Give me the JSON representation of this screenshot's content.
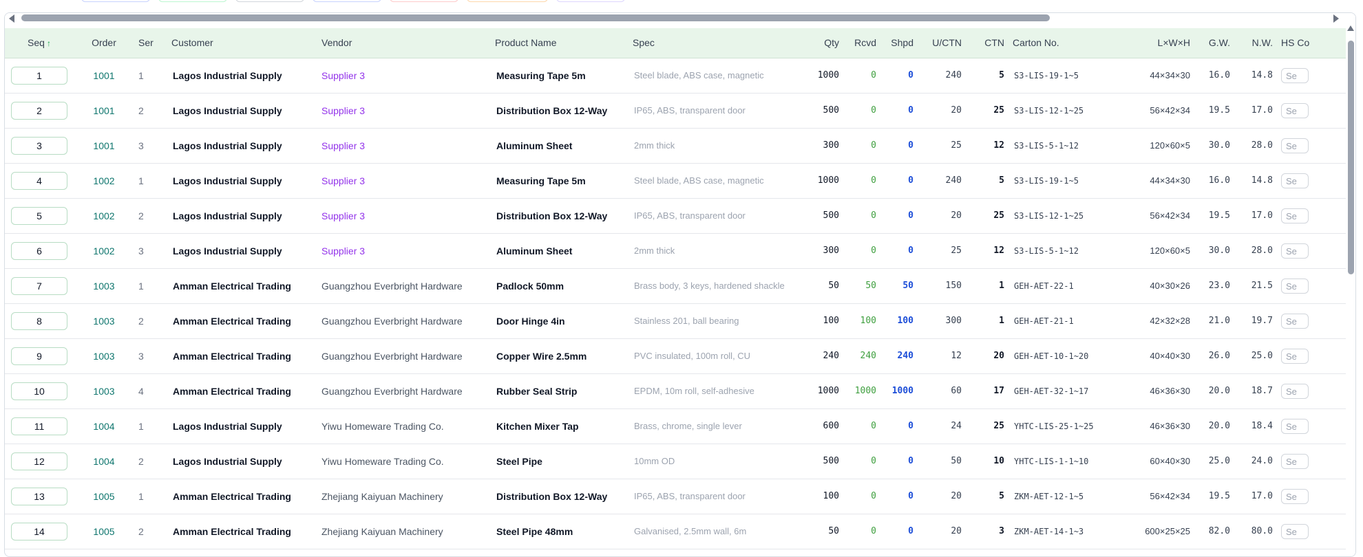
{
  "columns": {
    "seq": "Seq",
    "order": "Order",
    "ser": "Ser",
    "customer": "Customer",
    "vendor": "Vendor",
    "product": "Product Name",
    "spec": "Spec",
    "qty": "Qty",
    "rcvd": "Rcvd",
    "shpd": "Shpd",
    "uctn": "U/CTN",
    "ctn": "CTN",
    "carton": "Carton No.",
    "dims": "L×W×H",
    "gw": "G.W.",
    "nw": "N.W.",
    "hs": "HS Co"
  },
  "sort_indicator": "↑",
  "hs_button_label": "Se",
  "colors": {
    "header_bg": "#e8f5ea",
    "order_link": "#0f766e",
    "vendor_supplier": "#9333ea",
    "rcvd": "#3f9f3f",
    "shpd": "#1d4ed8"
  },
  "rows": [
    {
      "seq": "1",
      "order": "1001",
      "ser": "1",
      "customer": "Lagos Industrial Supply",
      "vendor": "Supplier 3",
      "vendor_style": "purple",
      "product": "Measuring Tape 5m",
      "spec": "Steel blade, ABS case, magnetic",
      "qty": "1000",
      "rcvd": "0",
      "shpd": "0",
      "uctn": "240",
      "ctn": "5",
      "carton": "S3-LIS-19-1~5",
      "dims": "44×34×30",
      "gw": "16.0",
      "nw": "14.8"
    },
    {
      "seq": "2",
      "order": "1001",
      "ser": "2",
      "customer": "Lagos Industrial Supply",
      "vendor": "Supplier 3",
      "vendor_style": "purple",
      "product": "Distribution Box 12-Way",
      "spec": "IP65, ABS, transparent door",
      "qty": "500",
      "rcvd": "0",
      "shpd": "0",
      "uctn": "20",
      "ctn": "25",
      "carton": "S3-LIS-12-1~25",
      "dims": "56×42×34",
      "gw": "19.5",
      "nw": "17.0"
    },
    {
      "seq": "3",
      "order": "1001",
      "ser": "3",
      "customer": "Lagos Industrial Supply",
      "vendor": "Supplier 3",
      "vendor_style": "purple",
      "product": "Aluminum Sheet",
      "spec": "2mm thick",
      "qty": "300",
      "rcvd": "0",
      "shpd": "0",
      "uctn": "25",
      "ctn": "12",
      "carton": "S3-LIS-5-1~12",
      "dims": "120×60×5",
      "gw": "30.0",
      "nw": "28.0"
    },
    {
      "seq": "4",
      "order": "1002",
      "ser": "1",
      "customer": "Lagos Industrial Supply",
      "vendor": "Supplier 3",
      "vendor_style": "purple",
      "product": "Measuring Tape 5m",
      "spec": "Steel blade, ABS case, magnetic",
      "qty": "1000",
      "rcvd": "0",
      "shpd": "0",
      "uctn": "240",
      "ctn": "5",
      "carton": "S3-LIS-19-1~5",
      "dims": "44×34×30",
      "gw": "16.0",
      "nw": "14.8"
    },
    {
      "seq": "5",
      "order": "1002",
      "ser": "2",
      "customer": "Lagos Industrial Supply",
      "vendor": "Supplier 3",
      "vendor_style": "purple",
      "product": "Distribution Box 12-Way",
      "spec": "IP65, ABS, transparent door",
      "qty": "500",
      "rcvd": "0",
      "shpd": "0",
      "uctn": "20",
      "ctn": "25",
      "carton": "S3-LIS-12-1~25",
      "dims": "56×42×34",
      "gw": "19.5",
      "nw": "17.0"
    },
    {
      "seq": "6",
      "order": "1002",
      "ser": "3",
      "customer": "Lagos Industrial Supply",
      "vendor": "Supplier 3",
      "vendor_style": "purple",
      "product": "Aluminum Sheet",
      "spec": "2mm thick",
      "qty": "300",
      "rcvd": "0",
      "shpd": "0",
      "uctn": "25",
      "ctn": "12",
      "carton": "S3-LIS-5-1~12",
      "dims": "120×60×5",
      "gw": "30.0",
      "nw": "28.0"
    },
    {
      "seq": "7",
      "order": "1003",
      "ser": "1",
      "customer": "Amman Electrical Trading",
      "vendor": "Guangzhou Everbright Hardware",
      "vendor_style": "gray",
      "product": "Padlock 50mm",
      "spec": "Brass body, 3 keys, hardened shackle",
      "qty": "50",
      "rcvd": "50",
      "shpd": "50",
      "uctn": "150",
      "ctn": "1",
      "carton": "GEH-AET-22-1",
      "dims": "40×30×26",
      "gw": "23.0",
      "nw": "21.5"
    },
    {
      "seq": "8",
      "order": "1003",
      "ser": "2",
      "customer": "Amman Electrical Trading",
      "vendor": "Guangzhou Everbright Hardware",
      "vendor_style": "gray",
      "product": "Door Hinge 4in",
      "spec": "Stainless 201, ball bearing",
      "qty": "100",
      "rcvd": "100",
      "shpd": "100",
      "uctn": "300",
      "ctn": "1",
      "carton": "GEH-AET-21-1",
      "dims": "42×32×28",
      "gw": "21.0",
      "nw": "19.7"
    },
    {
      "seq": "9",
      "order": "1003",
      "ser": "3",
      "customer": "Amman Electrical Trading",
      "vendor": "Guangzhou Everbright Hardware",
      "vendor_style": "gray",
      "product": "Copper Wire 2.5mm",
      "spec": "PVC insulated, 100m roll, CU",
      "qty": "240",
      "rcvd": "240",
      "shpd": "240",
      "uctn": "12",
      "ctn": "20",
      "carton": "GEH-AET-10-1~20",
      "dims": "40×40×30",
      "gw": "26.0",
      "nw": "25.0"
    },
    {
      "seq": "10",
      "order": "1003",
      "ser": "4",
      "customer": "Amman Electrical Trading",
      "vendor": "Guangzhou Everbright Hardware",
      "vendor_style": "gray",
      "product": "Rubber Seal Strip",
      "spec": "EPDM, 10m roll, self-adhesive",
      "qty": "1000",
      "rcvd": "1000",
      "shpd": "1000",
      "uctn": "60",
      "ctn": "17",
      "carton": "GEH-AET-32-1~17",
      "dims": "46×36×30",
      "gw": "20.0",
      "nw": "18.7"
    },
    {
      "seq": "11",
      "order": "1004",
      "ser": "1",
      "customer": "Lagos Industrial Supply",
      "vendor": "Yiwu Homeware Trading Co.",
      "vendor_style": "gray",
      "product": "Kitchen Mixer Tap",
      "spec": "Brass, chrome, single lever",
      "qty": "600",
      "rcvd": "0",
      "shpd": "0",
      "uctn": "24",
      "ctn": "25",
      "carton": "YHTC-LIS-25-1~25",
      "dims": "46×36×30",
      "gw": "20.0",
      "nw": "18.4"
    },
    {
      "seq": "12",
      "order": "1004",
      "ser": "2",
      "customer": "Lagos Industrial Supply",
      "vendor": "Yiwu Homeware Trading Co.",
      "vendor_style": "gray",
      "product": "Steel Pipe",
      "spec": "10mm OD",
      "qty": "500",
      "rcvd": "0",
      "shpd": "0",
      "uctn": "50",
      "ctn": "10",
      "carton": "YHTC-LIS-1-1~10",
      "dims": "60×40×30",
      "gw": "25.0",
      "nw": "24.0"
    },
    {
      "seq": "13",
      "order": "1005",
      "ser": "1",
      "customer": "Amman Electrical Trading",
      "vendor": "Zhejiang Kaiyuan Machinery",
      "vendor_style": "gray",
      "product": "Distribution Box 12-Way",
      "spec": "IP65, ABS, transparent door",
      "qty": "100",
      "rcvd": "0",
      "shpd": "0",
      "uctn": "20",
      "ctn": "5",
      "carton": "ZKM-AET-12-1~5",
      "dims": "56×42×34",
      "gw": "19.5",
      "nw": "17.0"
    },
    {
      "seq": "14",
      "order": "1005",
      "ser": "2",
      "customer": "Amman Electrical Trading",
      "vendor": "Zhejiang Kaiyuan Machinery",
      "vendor_style": "gray",
      "product": "Steel Pipe 48mm",
      "spec": "Galvanised, 2.5mm wall, 6m",
      "qty": "50",
      "rcvd": "0",
      "shpd": "0",
      "uctn": "20",
      "ctn": "3",
      "carton": "ZKM-AET-14-1~3",
      "dims": "600×25×25",
      "gw": "82.0",
      "nw": "80.0"
    }
  ]
}
